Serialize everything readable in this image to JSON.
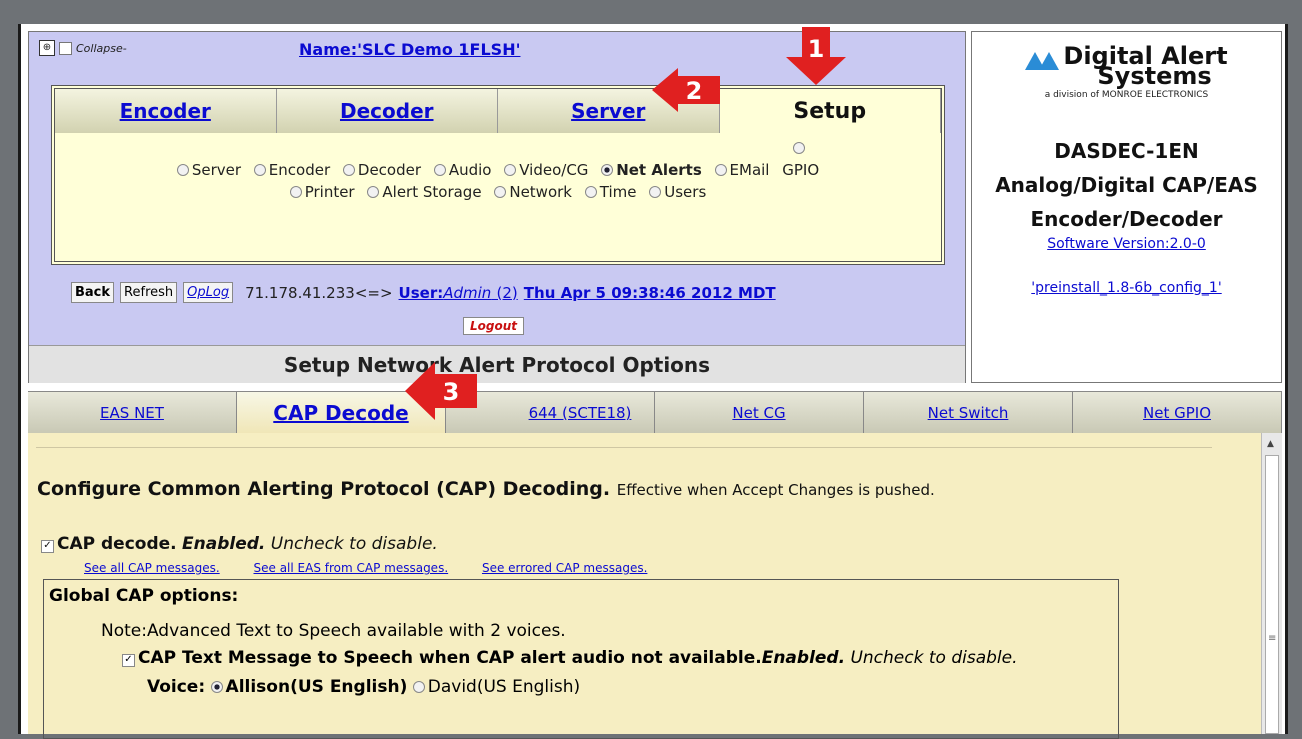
{
  "header": {
    "collapse_label": "Collapse-",
    "device_name": "Name:'SLC Demo 1FLSH'",
    "main_tabs": [
      "Encoder",
      "Decoder",
      "Server",
      "Setup"
    ],
    "radios": [
      {
        "label": "Server",
        "selected": false
      },
      {
        "label": "Encoder",
        "selected": false
      },
      {
        "label": "Decoder",
        "selected": false
      },
      {
        "label": "Audio",
        "selected": false
      },
      {
        "label": "Video/CG",
        "selected": false
      },
      {
        "label": "Net Alerts",
        "selected": true
      },
      {
        "label": "EMail",
        "selected": false
      },
      {
        "label": "GPIO",
        "selected": false
      },
      {
        "label": "Printer",
        "selected": false
      },
      {
        "label": "Alert Storage",
        "selected": false
      },
      {
        "label": "Network",
        "selected": false
      },
      {
        "label": "Time",
        "selected": false
      },
      {
        "label": "Users",
        "selected": false
      }
    ],
    "toolbar": {
      "back": "Back",
      "refresh": "Refresh",
      "oplog": "OpLog",
      "ip": "71.178.41.233<=>",
      "user_prefix": "User:",
      "user_name": "Admin",
      "user_count": "(2)",
      "datetime": "Thu Apr 5 09:38:46 2012 MDT",
      "logout": "Logout"
    },
    "page_title": "Setup Network Alert Protocol Options"
  },
  "brand": {
    "logo_line1": "Digital Alert",
    "logo_line2": "Systems",
    "division": "a division of MONROE ELECTRONICS",
    "model_line1": "DASDEC-1EN",
    "model_line2": "Analog/Digital CAP/EAS",
    "model_line3": "Encoder/Decoder",
    "software_version": "Software Version:2.0-0",
    "config": "'preinstall_1.8-6b_config_1'"
  },
  "subtabs": [
    "EAS NET",
    "CAP Decode",
    "J-STD-044 (SCTE18)",
    "Net CG",
    "Net Switch",
    "Net GPIO"
  ],
  "subtab_3_visible": "644 (SCTE18)",
  "content": {
    "title": "Configure Common Alerting Protocol (CAP) Decoding.",
    "title_note": "Effective when Accept Changes is pushed.",
    "cap_decode_bold": "CAP decode.",
    "cap_decode_enabled": "Enabled.",
    "cap_decode_hint": "Uncheck to disable.",
    "links": [
      "See all CAP messages.",
      "See all EAS from CAP messages.",
      "See errored CAP messages."
    ],
    "global_title": "Global CAP options:",
    "tts_note": "Note:Advanced Text to Speech available with 2 voices.",
    "speech_option": "CAP Text Message to Speech when CAP alert audio not available.",
    "speech_enabled": "Enabled.",
    "speech_hint": "Uncheck to disable.",
    "voice_label": "Voice:",
    "voices": [
      {
        "label": "Allison(US English)",
        "selected": true
      },
      {
        "label": "David(US English)",
        "selected": false
      }
    ]
  },
  "callouts": [
    "1",
    "2",
    "3"
  ],
  "colors": {
    "callout_red": "#e02020",
    "header_bg": "#c9c9f2",
    "content_bg": "#f6eec2"
  }
}
